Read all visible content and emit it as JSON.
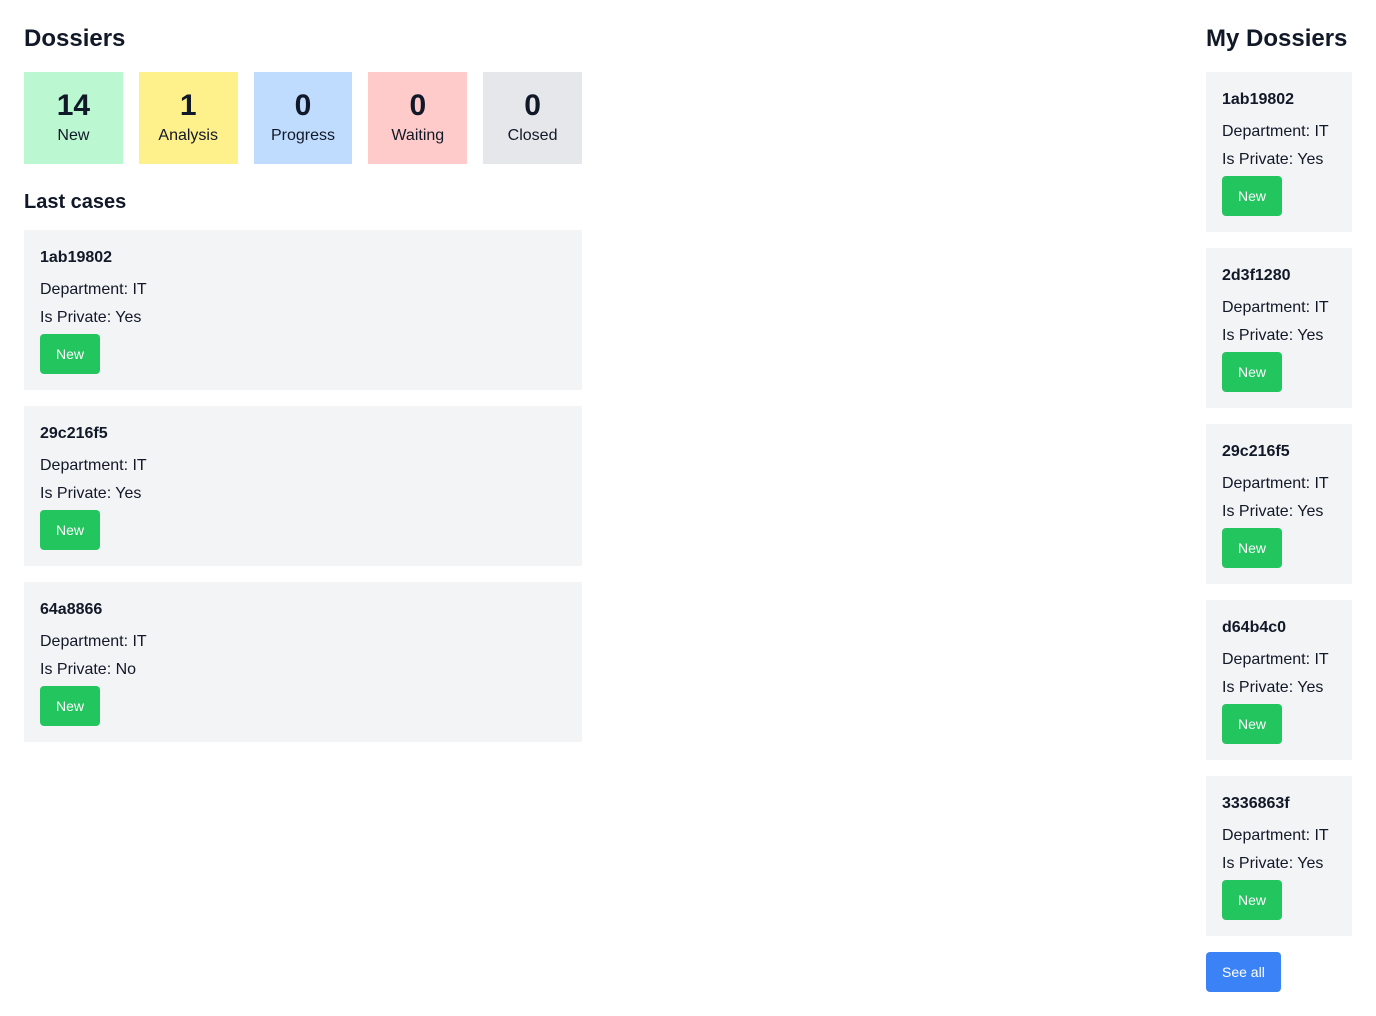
{
  "dossiers": {
    "title": "Dossiers",
    "stats": [
      {
        "count": "14",
        "label": "New",
        "color": "#bbf7d0"
      },
      {
        "count": "1",
        "label": "Analysis",
        "color": "#fef08a"
      },
      {
        "count": "0",
        "label": "Progress",
        "color": "#bfdbfe"
      },
      {
        "count": "0",
        "label": "Waiting",
        "color": "#fecaca"
      },
      {
        "count": "0",
        "label": "Closed",
        "color": "#e5e7eb"
      }
    ]
  },
  "last_cases": {
    "title": "Last cases",
    "items": [
      {
        "id": "1ab19802",
        "department": "Department: IT",
        "private": "Is Private: Yes",
        "status": "New"
      },
      {
        "id": "29c216f5",
        "department": "Department: IT",
        "private": "Is Private: Yes",
        "status": "New"
      },
      {
        "id": "64a8866",
        "department": "Department: IT",
        "private": "Is Private: No",
        "status": "New"
      }
    ]
  },
  "my_dossiers": {
    "title": "My Dossiers",
    "items": [
      {
        "id": "1ab19802",
        "department": "Department: IT",
        "private": "Is Private: Yes",
        "status": "New"
      },
      {
        "id": "2d3f1280",
        "department": "Department: IT",
        "private": "Is Private: Yes",
        "status": "New"
      },
      {
        "id": "29c216f5",
        "department": "Department: IT",
        "private": "Is Private: Yes",
        "status": "New"
      },
      {
        "id": "d64b4c0",
        "department": "Department: IT",
        "private": "Is Private: Yes",
        "status": "New"
      },
      {
        "id": "3336863f",
        "department": "Department: IT",
        "private": "Is Private: Yes",
        "status": "New"
      }
    ],
    "see_all_label": "See all"
  },
  "colors": {
    "card_bg": "#f3f4f6",
    "status_new": "#22c55e",
    "see_all": "#3b82f6"
  }
}
